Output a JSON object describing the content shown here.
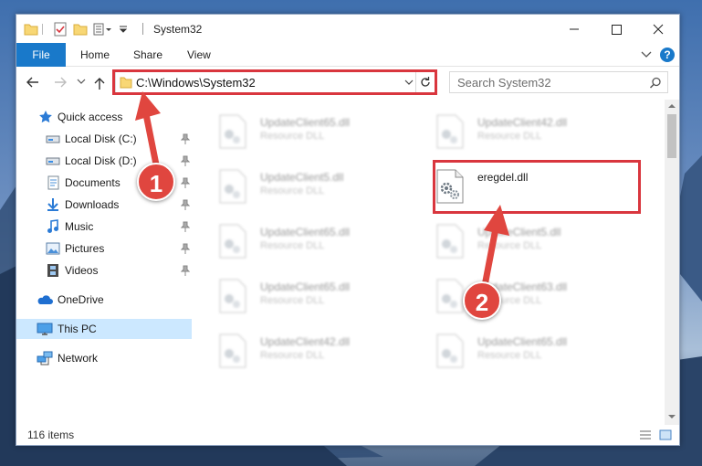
{
  "window": {
    "title": "System32"
  },
  "ribbon": {
    "tabs": [
      {
        "label": "File"
      },
      {
        "label": "Home"
      },
      {
        "label": "Share"
      },
      {
        "label": "View"
      }
    ],
    "help_label": "?"
  },
  "navigation": {
    "address": "C:\\Windows\\System32",
    "search_placeholder": "Search System32"
  },
  "nav_pane": {
    "quick_access": {
      "label": "Quick access"
    },
    "items": [
      {
        "label": "Local Disk (C:)",
        "icon": "drive-icon",
        "pinned": true
      },
      {
        "label": "Local Disk (D:)",
        "icon": "drive-icon",
        "pinned": true
      },
      {
        "label": "Documents",
        "icon": "documents-icon",
        "pinned": true
      },
      {
        "label": "Downloads",
        "icon": "download-icon",
        "pinned": true
      },
      {
        "label": "Music",
        "icon": "music-icon",
        "pinned": true
      },
      {
        "label": "Pictures",
        "icon": "pictures-icon",
        "pinned": true
      },
      {
        "label": "Videos",
        "icon": "videos-icon",
        "pinned": true
      }
    ],
    "onedrive": {
      "label": "OneDrive"
    },
    "this_pc": {
      "label": "This PC"
    },
    "network": {
      "label": "Network"
    }
  },
  "files": {
    "left_column": [
      {
        "name": "UpdateClient65.dll",
        "desc": "Resource DLL"
      },
      {
        "name": "UpdateClient5.dll",
        "desc": "Resource DLL"
      },
      {
        "name": "UpdateClient65.dll",
        "desc": "Resource DLL"
      },
      {
        "name": "UpdateClient65.dll",
        "desc": "Resource DLL"
      },
      {
        "name": "UpdateClient42.dll",
        "desc": "Resource DLL"
      }
    ],
    "right_column": [
      {
        "name": "UpdateClient42.dll",
        "desc": "Resource DLL"
      },
      {
        "name": "eregdel.dll",
        "desc": ""
      },
      {
        "name": "UpdateClient5.dll",
        "desc": "Resource DLL"
      },
      {
        "name": "UpdateClient63.dll",
        "desc": "Resource DLL"
      },
      {
        "name": "UpdateClient65.dll",
        "desc": "Resource DLL"
      }
    ]
  },
  "status": {
    "items_count": "116 items"
  },
  "annotations": {
    "step1": "1",
    "step2": "2",
    "highlight_color": "#d9363e"
  },
  "colors": {
    "accent": "#1979ca",
    "selection": "#cce8ff"
  }
}
